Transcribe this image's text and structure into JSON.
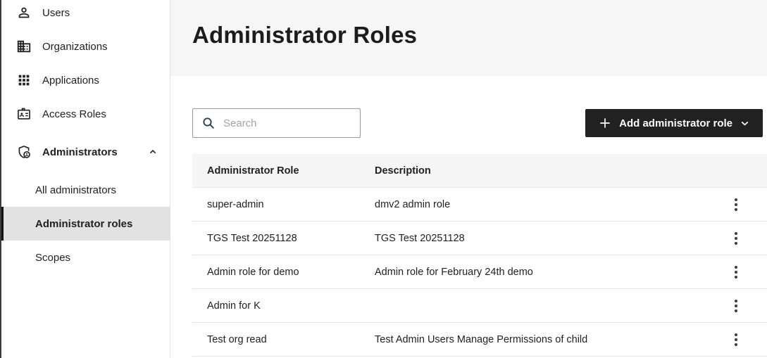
{
  "sidebar": {
    "items": [
      {
        "label": "Users",
        "icon": "person-icon"
      },
      {
        "label": "Organizations",
        "icon": "building-icon"
      },
      {
        "label": "Applications",
        "icon": "apps-grid-icon"
      },
      {
        "label": "Access Roles",
        "icon": "badge-icon"
      },
      {
        "label": "Administrators",
        "icon": "shield-person-icon",
        "expanded": true
      }
    ],
    "sub_items": [
      {
        "label": "All administrators",
        "selected": false
      },
      {
        "label": "Administrator roles",
        "selected": true
      },
      {
        "label": "Scopes",
        "selected": false
      }
    ]
  },
  "header": {
    "title": "Administrator Roles"
  },
  "toolbar": {
    "search_placeholder": "Search",
    "search_value": "",
    "add_button_label": "Add administrator role"
  },
  "table": {
    "columns": [
      "Administrator Role",
      "Description"
    ],
    "rows": [
      {
        "role": "super-admin",
        "description": "dmv2 admin role"
      },
      {
        "role": "TGS Test 20251128",
        "description": "TGS Test 20251128"
      },
      {
        "role": "Admin role for demo",
        "description": "Admin role for February 24th demo"
      },
      {
        "role": "Admin for K",
        "description": ""
      },
      {
        "role": "Test org read",
        "description": "Test Admin Users Manage Permissions of child"
      }
    ]
  },
  "colors": {
    "button_bg": "#212121",
    "page_header_bg": "#f5f6f5",
    "table_header_bg": "#f5f5f5",
    "selected_item_bg": "#e2e2e2",
    "selected_indicator": "#121212",
    "divider": "#e3e3e3",
    "search_icon": "#2c3b4a",
    "placeholder_text": "#a3a3a3"
  }
}
